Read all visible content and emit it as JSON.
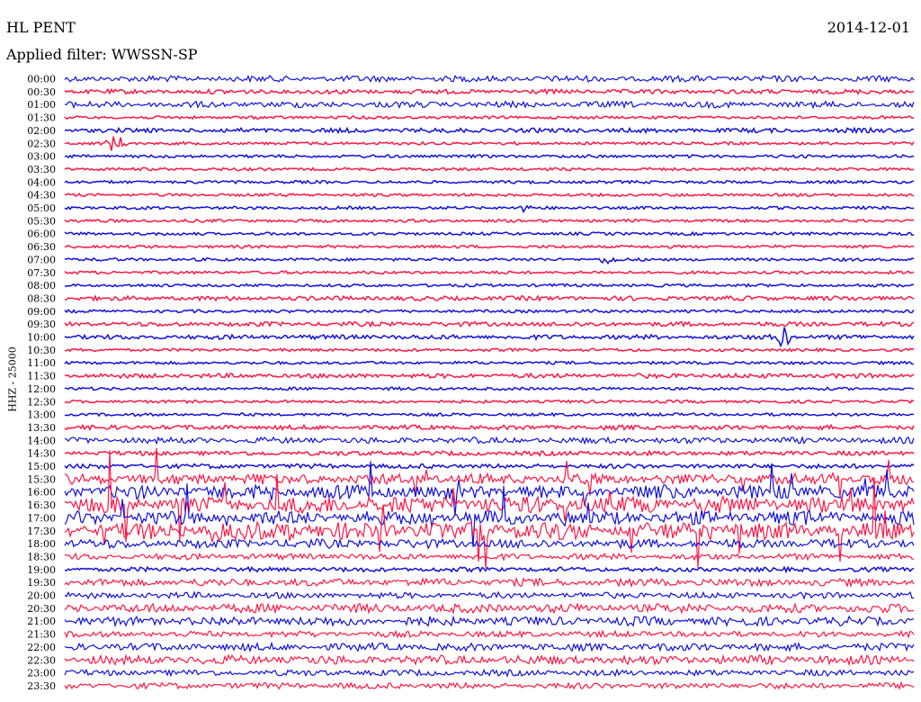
{
  "header": {
    "station": "HL PENT",
    "date": "2014-12-01",
    "filter": "Applied filter: WWSSN-SP",
    "channel_label": "HHZ - 25000"
  },
  "colors": {
    "even_trace": "#1010dd",
    "odd_trace": "#ff1744",
    "background": "#ffffff",
    "text": "#000000"
  },
  "chart_data": {
    "type": "line",
    "title": "HL PENT",
    "subtitle": "Applied filter: WWSSN-SP",
    "ylabel": "HHZ - 25000",
    "xlabel": "",
    "grid": false,
    "legend": "none",
    "trace_labels": [
      "00:00",
      "00:30",
      "01:00",
      "01:30",
      "02:00",
      "02:30",
      "03:00",
      "03:30",
      "04:00",
      "04:30",
      "05:00",
      "05:30",
      "06:00",
      "06:30",
      "07:00",
      "07:30",
      "08:00",
      "08:30",
      "09:00",
      "09:30",
      "10:00",
      "10:30",
      "11:00",
      "11:30",
      "12:00",
      "12:30",
      "13:00",
      "13:30",
      "14:00",
      "14:30",
      "15:00",
      "15:30",
      "16:00",
      "16:30",
      "17:00",
      "17:30",
      "18:00",
      "18:30",
      "19:00",
      "19:30",
      "20:00",
      "20:30",
      "21:00",
      "21:30",
      "22:00",
      "22:30",
      "23:00",
      "23:30"
    ],
    "activity": [
      3,
      2,
      3,
      1,
      2,
      1,
      1,
      1,
      1,
      1,
      1,
      1,
      1,
      1,
      1,
      1,
      1,
      2,
      1,
      2,
      2,
      1,
      1,
      2,
      1,
      1,
      1,
      2,
      3,
      2,
      2,
      6,
      8,
      10,
      8,
      10,
      5,
      3,
      2,
      4,
      3,
      5,
      5,
      3,
      4,
      5,
      3,
      3
    ],
    "events": [
      {
        "label": "10:00",
        "position": 0.845,
        "amplitude": 12
      },
      {
        "label": "02:30",
        "position": 0.06,
        "amplitude": 10
      },
      {
        "label": "07:00",
        "position": 0.64,
        "amplitude": 4
      },
      {
        "label": "05:00",
        "position": 0.54,
        "amplitude": 3
      }
    ]
  }
}
